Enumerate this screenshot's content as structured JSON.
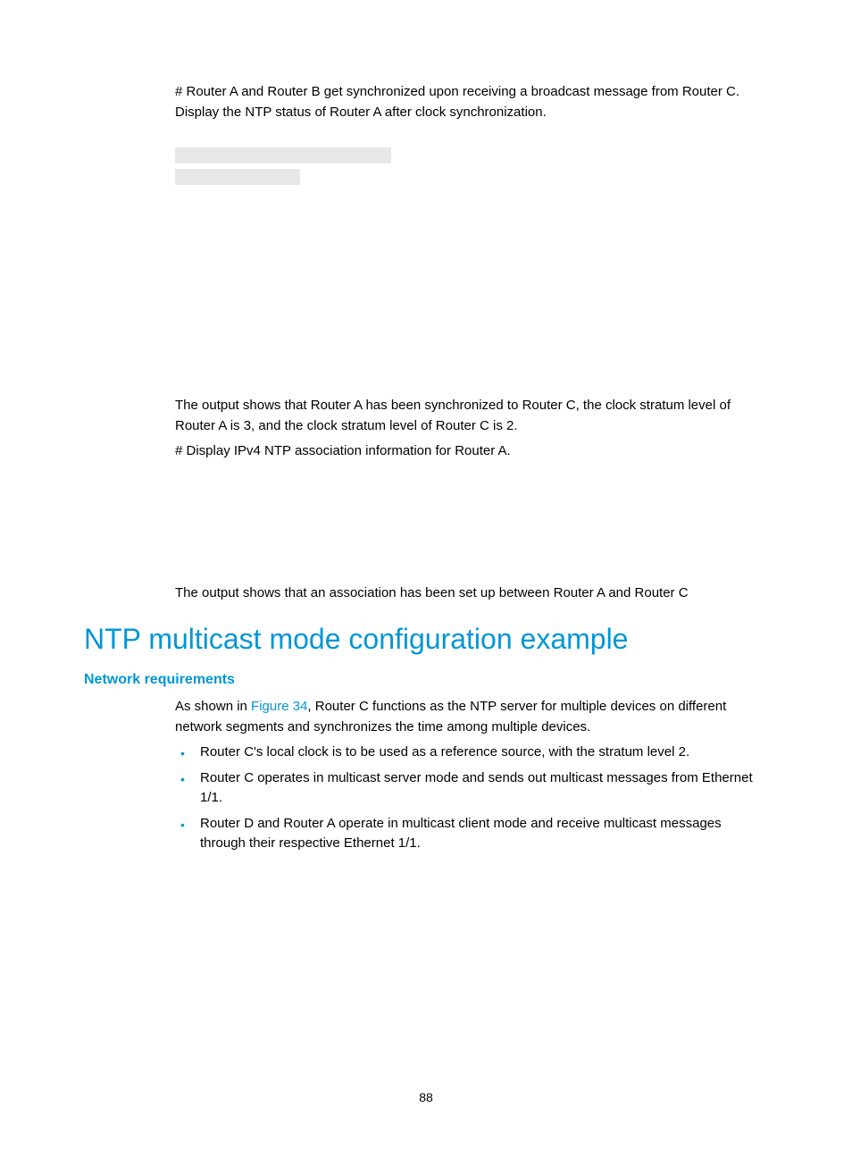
{
  "para1": "# Router A and Router B get synchronized upon receiving a broadcast message from Router C. Display the NTP status of Router A after clock synchronization.",
  "para2": "The output shows that Router A has been synchronized to Router C, the clock stratum level of Router A is 3, and the clock stratum level of Router C is 2.",
  "para3": "# Display IPv4 NTP association information for Router A.",
  "para4": "The output shows that an association has been set up between Router A and Router C",
  "section_heading": "NTP multicast mode configuration example",
  "sub_heading": "Network requirements",
  "intro_part1": "As shown in ",
  "intro_link": "Figure 34",
  "intro_part2": ", Router C functions as the NTP server for multiple devices on different network segments and synchronizes the time among multiple devices.",
  "bullets": [
    "Router C's local clock is to be used as a reference source, with the stratum level 2.",
    "Router C operates in multicast server mode and sends out multicast messages from Ethernet 1/1.",
    "Router D and Router A operate in multicast client mode and receive multicast messages through their respective Ethernet 1/1."
  ],
  "page_number": "88"
}
